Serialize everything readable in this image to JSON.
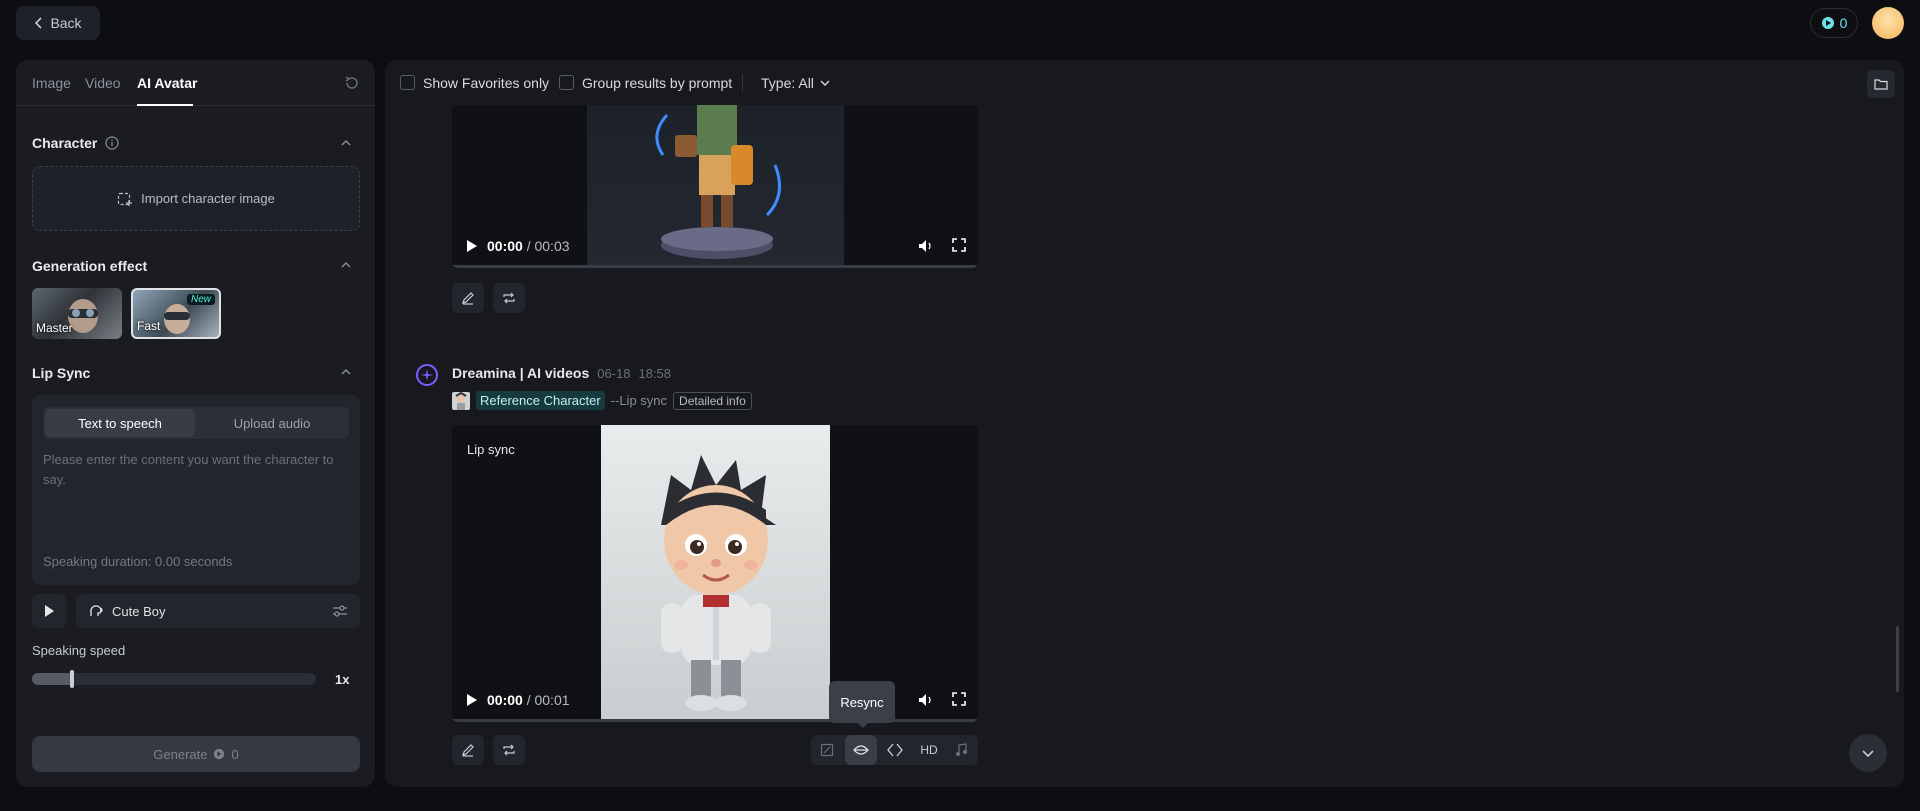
{
  "header": {
    "back_label": "Back",
    "credits": "0"
  },
  "left_panel": {
    "tabs": [
      {
        "label": "Image"
      },
      {
        "label": "Video"
      },
      {
        "label": "AI Avatar"
      }
    ],
    "character": {
      "title": "Character",
      "import_label": "Import character image"
    },
    "generation_effect": {
      "title": "Generation effect",
      "options": [
        {
          "label": "Master"
        },
        {
          "label": "Fast",
          "badge": "New"
        }
      ]
    },
    "lip_sync": {
      "title": "Lip Sync",
      "segments": [
        {
          "label": "Text to speech"
        },
        {
          "label": "Upload audio"
        }
      ],
      "placeholder": "Please enter the content you want the character to say.",
      "duration": "Speaking duration: 0.00 seconds",
      "voice": "Cute Boy"
    },
    "speed": {
      "title": "Speaking speed",
      "value_label": "1x",
      "level": 0.14
    },
    "generate": {
      "label": "Generate",
      "cost": "0"
    }
  },
  "main": {
    "toolbar": {
      "favorites_label": "Show Favorites only",
      "group_label": "Group results by prompt",
      "type_label": "Type: All"
    },
    "video1": {
      "time_current": "00:00",
      "time_total": "/ 00:03"
    },
    "video2": {
      "author": "Dreamina | AI videos",
      "date": "06-18",
      "time": "18:58",
      "ref_tag": "Reference Character",
      "mode_tag": "--Lip sync",
      "detailed": "Detailed info",
      "overlay_label": "Lip sync",
      "time_current": "00:00",
      "time_total": "/ 00:01"
    },
    "tooltip": "Resync",
    "hd_label": "HD"
  },
  "colors": {
    "accent": "#6ee0ec",
    "badge": "#4ff0d8",
    "brand_purple": "#7b5cff"
  }
}
